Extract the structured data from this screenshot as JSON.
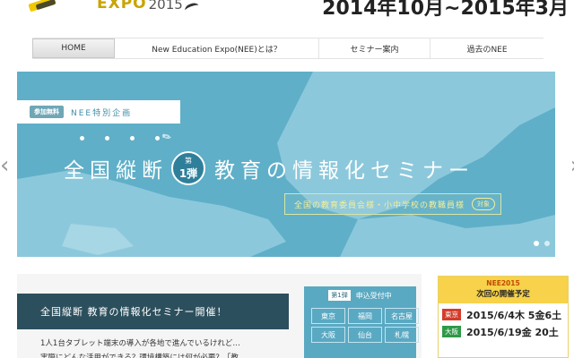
{
  "header": {
    "logo_text": "EXPO",
    "logo_year": "2015",
    "period": "2014年10月~2015年3月"
  },
  "nav": {
    "items": [
      {
        "label": "HOME"
      },
      {
        "label": "New Education Expo(NEE)とは？"
      },
      {
        "label": "セミナー案内"
      },
      {
        "label": "過去のNEE"
      }
    ]
  },
  "slider": {
    "badge_free": "参加無料",
    "badge_label": "NEE特別企画",
    "title_part1": "全国縦断",
    "vol_top": "第",
    "vol_num": "1弾",
    "title_part2": "教育の情報化セミナー",
    "target_text": "全国の教育委員会様・小中学校の教職員様",
    "target_badge": "対象",
    "bg_color": "#5fafc8",
    "land_color": "#8cc8db",
    "arrow_left": "‹",
    "arrow_right": "›"
  },
  "article": {
    "heading": "全国縦断 教育の情報化セミナー開催！",
    "body_line1": "1人1台タブレット端末の導入が各地で進んでいるけれど…",
    "body_line2": "実際にどんな活用ができる？環境構築には何が必要？「教"
  },
  "signup": {
    "badge": "第1弾",
    "label": "申込受付中",
    "cities": [
      "東京",
      "福岡",
      "名古屋",
      "大阪",
      "仙台",
      "札幌"
    ]
  },
  "schedule": {
    "sup": "NEE2015",
    "title": "次回の開催予定",
    "rows": [
      {
        "city": "東京",
        "date": "2015/6/4木 5金6土"
      },
      {
        "city": "大阪",
        "date": "2015/6/19金 20土"
      }
    ]
  }
}
